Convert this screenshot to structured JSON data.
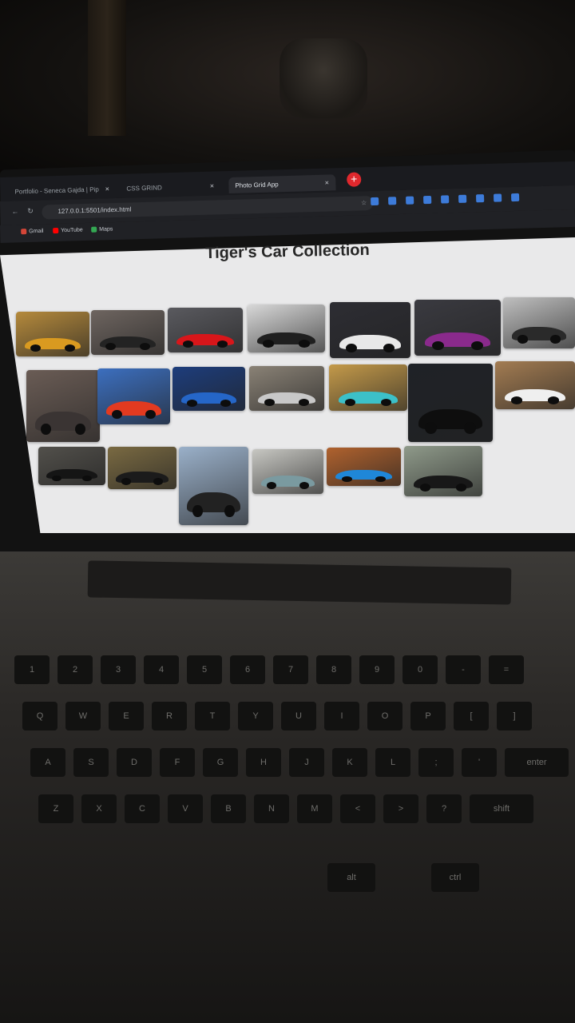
{
  "browser": {
    "tabs": [
      {
        "label": "Portfolio - Seneca Gajda | Pip",
        "active": false
      },
      {
        "label": "CSS GRIND",
        "active": false
      },
      {
        "label": "Photo Grid App",
        "active": true
      }
    ],
    "new_tab_glyph": "+",
    "close_glyph": "×",
    "address": "127.0.0.1:5501/index.html",
    "bookmarks": [
      "Gmail",
      "YouTube",
      "Maps"
    ]
  },
  "page": {
    "title": "Tiger's Car Collection",
    "photos": [
      {
        "bg": "#b58a3c",
        "car": "#d99a20"
      },
      {
        "bg": "#6e6560",
        "car": "#232323"
      },
      {
        "bg": "#5a5a5f",
        "car": "#d8161a"
      },
      {
        "bg": "#d8d8d8",
        "car": "#1f1f1f"
      },
      {
        "bg": "#2d2d33",
        "car": "#e8e8e8"
      },
      {
        "bg": "#3a3a40",
        "car": "#8a2a8c"
      },
      {
        "bg": "#bfbfbf",
        "car": "#2a2a2a"
      },
      {
        "bg": "#6a5c55",
        "car": "#3a3433"
      },
      {
        "bg": "#3c6fbf",
        "car": "#e23a20"
      },
      {
        "bg": "#1d3d7c",
        "car": "#2566c8"
      },
      {
        "bg": "#8a8276",
        "car": "#c8c8c8"
      },
      {
        "bg": "#c49a4a",
        "car": "#3cc0c8"
      },
      {
        "bg": "#1f2227",
        "car": "#0e0e0e"
      },
      {
        "bg": "#a37c52",
        "car": "#efefef"
      },
      {
        "bg": "#52504b",
        "car": "#151515"
      },
      {
        "bg": "#7a6a42",
        "car": "#1b1b1b"
      },
      {
        "bg": "#9ab0c9",
        "car": "#222"
      },
      {
        "bg": "#c7c7c2",
        "car": "#7a9aa0"
      },
      {
        "bg": "#b0622e",
        "car": "#1f87d8"
      },
      {
        "bg": "#8f9a8a",
        "car": "#181818"
      }
    ]
  },
  "keyboard": {
    "rows": [
      [
        "1",
        "2",
        "3",
        "4",
        "5",
        "6",
        "7",
        "8",
        "9",
        "0",
        "-",
        "="
      ],
      [
        "Q",
        "W",
        "E",
        "R",
        "T",
        "Y",
        "U",
        "I",
        "O",
        "P",
        "[",
        "]"
      ],
      [
        "A",
        "S",
        "D",
        "F",
        "G",
        "H",
        "J",
        "K",
        "L",
        ";",
        "'",
        "enter"
      ],
      [
        "Z",
        "X",
        "C",
        "V",
        "B",
        "N",
        "M",
        "<",
        ">",
        "?",
        "shift"
      ],
      [
        "alt",
        "ctrl"
      ]
    ]
  }
}
